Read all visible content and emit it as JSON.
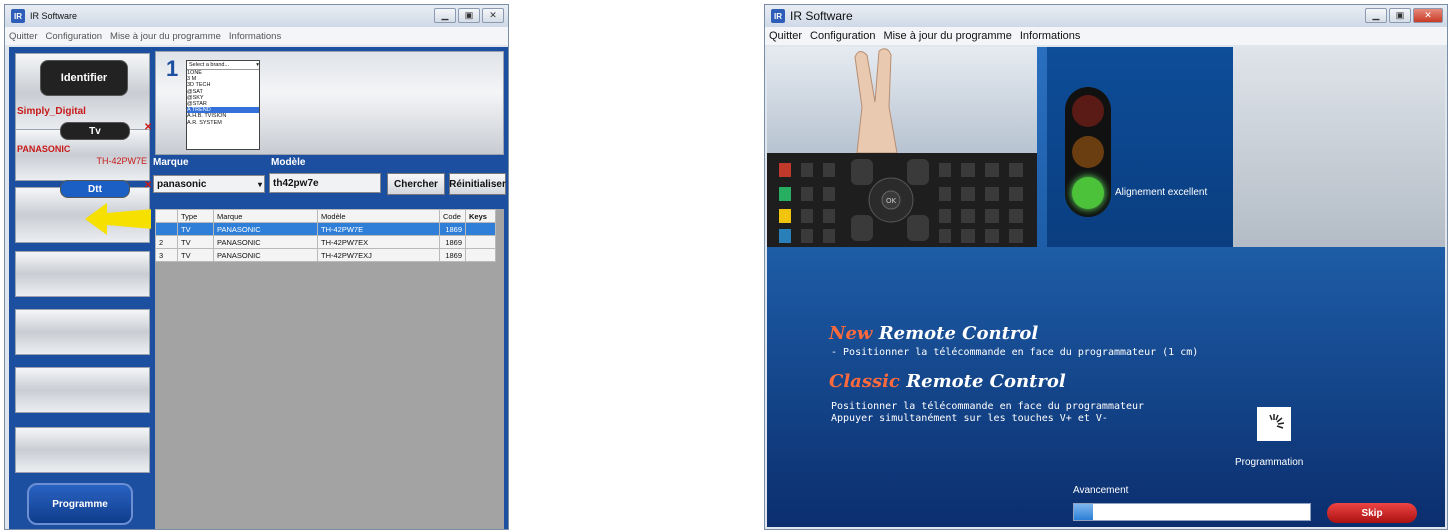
{
  "left_window": {
    "title": "IR Software",
    "menu": [
      "Quitter",
      "Configuration",
      "Mise à jour du programme",
      "Informations"
    ],
    "identify_button": "Identifier",
    "slot_device": "Simply_Digital",
    "tv_pill": "Tv",
    "tv_brand": "PANASONIC",
    "tv_model": "TH-42PW7E",
    "dtt_pill": "Dtt",
    "step_number": "1",
    "brand_select_placeholder": "Select a brand...",
    "brand_list": [
      "1ONE",
      "3 M",
      "3D TECH",
      "@SAT",
      "@SKY",
      "@STAR",
      "A TREND",
      "A.H.B. TVISION",
      "A.R. SYSTEM"
    ],
    "brand_list_selected_index": 6,
    "marque_label": "Marque",
    "modele_label": "Modèle",
    "marque_value": "panasonic",
    "modele_value": "th42pw7e",
    "search_button": "Chercher",
    "reset_button": "Réinitialiser",
    "table": {
      "headers": [
        "",
        "Type",
        "Marque",
        "Modèle",
        "Code",
        "Keys"
      ],
      "rows": [
        [
          "",
          "TV",
          "PANASONIC",
          "TH-42PW7E",
          "1869",
          ""
        ],
        [
          "2",
          "TV",
          "PANASONIC",
          "TH-42PW7EX",
          "1869",
          ""
        ],
        [
          "3",
          "TV",
          "PANASONIC",
          "TH-42PW7EXJ",
          "1869",
          ""
        ]
      ]
    },
    "program_button": "Programme"
  },
  "right_window": {
    "title": "IR Software",
    "menu": [
      "Quitter",
      "Configuration",
      "Mise à jour du programme",
      "Informations"
    ],
    "alignment_status": "Alignement excellent",
    "new_accent": "New",
    "new_title": "Remote Control",
    "new_instruction": "- Positionner la télécommande en face du programmateur (1 cm)",
    "classic_accent": "Classic",
    "classic_title": "Remote Control",
    "classic_instruction_1": "Positionner la télécommande en face du programmateur",
    "classic_instruction_2": "Appuyer simultanément sur les touches V+ et V-",
    "programming_label": "Programmation",
    "progress_label": "Avancement",
    "progress_fraction": 0.08,
    "skip_button": "Skip"
  }
}
